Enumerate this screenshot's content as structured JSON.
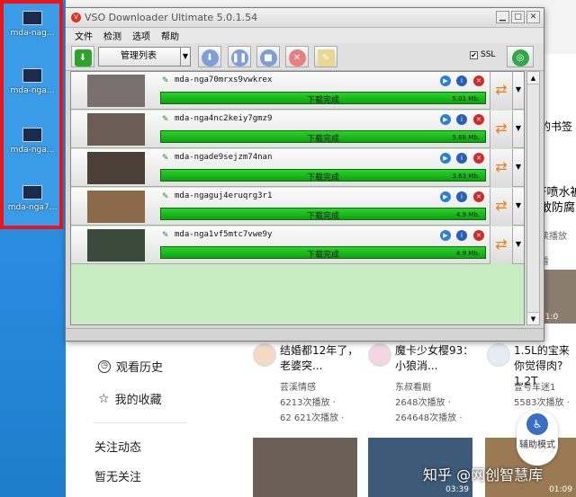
{
  "desktop": {
    "icons": [
      "mda-nag...",
      "mda-nga...",
      "mda-nga...",
      "mda-nga7..."
    ]
  },
  "app": {
    "title": "VSO Downloader Ultimate 5.0.1.54",
    "menu": [
      "文件",
      "检测",
      "选项",
      "帮助"
    ],
    "list_select": "管理列表",
    "ssl_label": "SSL",
    "ssl_checked": "✔",
    "items": [
      {
        "name": "mda-nga70mrxs9vwkrex",
        "status": "下载完成",
        "size": "5.01 Mb."
      },
      {
        "name": "mda-nga4nc2keiy7gmz9",
        "status": "下载完成",
        "size": "5.68 Mb."
      },
      {
        "name": "mda-ngade9sejzm74nan",
        "status": "下载完成",
        "size": "3.63 Mb."
      },
      {
        "name": "mda-ngaguj4eruqrg3r1",
        "status": "下载完成",
        "size": "4.9 Mb."
      },
      {
        "name": "mda-nga1vf5mtc7vwe9y",
        "status": "下载完成",
        "size": "4.9 Mb."
      }
    ],
    "colors": {
      "progress": "#1cb81c",
      "list_bg": "#c8edc4",
      "accent": "#2a7fd6"
    }
  },
  "web": {
    "right_snippets": [
      "的书签",
      "F喷水被",
      "敢防腐",
      "z",
      "读播放",
      "看",
      "01:0"
    ],
    "side": {
      "history": "观看历史",
      "favorites": "我的收藏",
      "follow": "关注动态",
      "no_follow": "暂无关注"
    },
    "cards": [
      {
        "title": "结婚都12年了，老婆突...",
        "author": "芸溪情感",
        "plays": "6213次播放 ·",
        "extra": "62  621次播放 ·"
      },
      {
        "title": "魔卡少女樱93：小狼消...",
        "author": "东叔看剧",
        "plays": "2648次播放 ·",
        "extra": "264648次播放 ·"
      },
      {
        "title": "1.5L的宝来你觉得肉? 1.2T",
        "author": "壹号车迷1",
        "plays": "5583次播放 ·",
        "extra": "5583次播放 ·"
      }
    ],
    "video_durations": [
      "",
      "03:39",
      "01:09"
    ],
    "help_button": "辅助模式",
    "watermark": "知乎 @网创智慧库"
  }
}
